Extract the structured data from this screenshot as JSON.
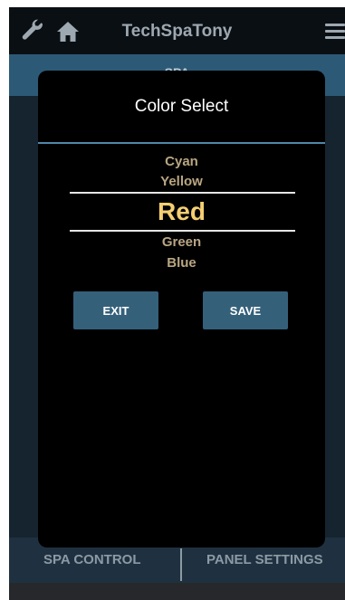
{
  "appbar": {
    "title": "TechSpaTony",
    "icons": [
      "wrench-icon",
      "home-icon",
      "menu-icon"
    ]
  },
  "subheader": {
    "label": "SPA"
  },
  "tabs": {
    "spa_control": "SPA CONTROL",
    "panel_settings": "PANEL SETTINGS"
  },
  "modal": {
    "title": "Color Select",
    "options": [
      "Cyan",
      "Yellow",
      "Red",
      "Green",
      "Blue"
    ],
    "selected": "Red",
    "exit_label": "EXIT",
    "save_label": "SAVE"
  },
  "colors": {
    "appbar_bg": "#0a0f14",
    "subheader_bg": "#2c5a76",
    "accent_rule": "#4f87a8",
    "selected_text": "#f5cf72",
    "option_text": "#b9a683",
    "button_bg": "#35607a"
  }
}
